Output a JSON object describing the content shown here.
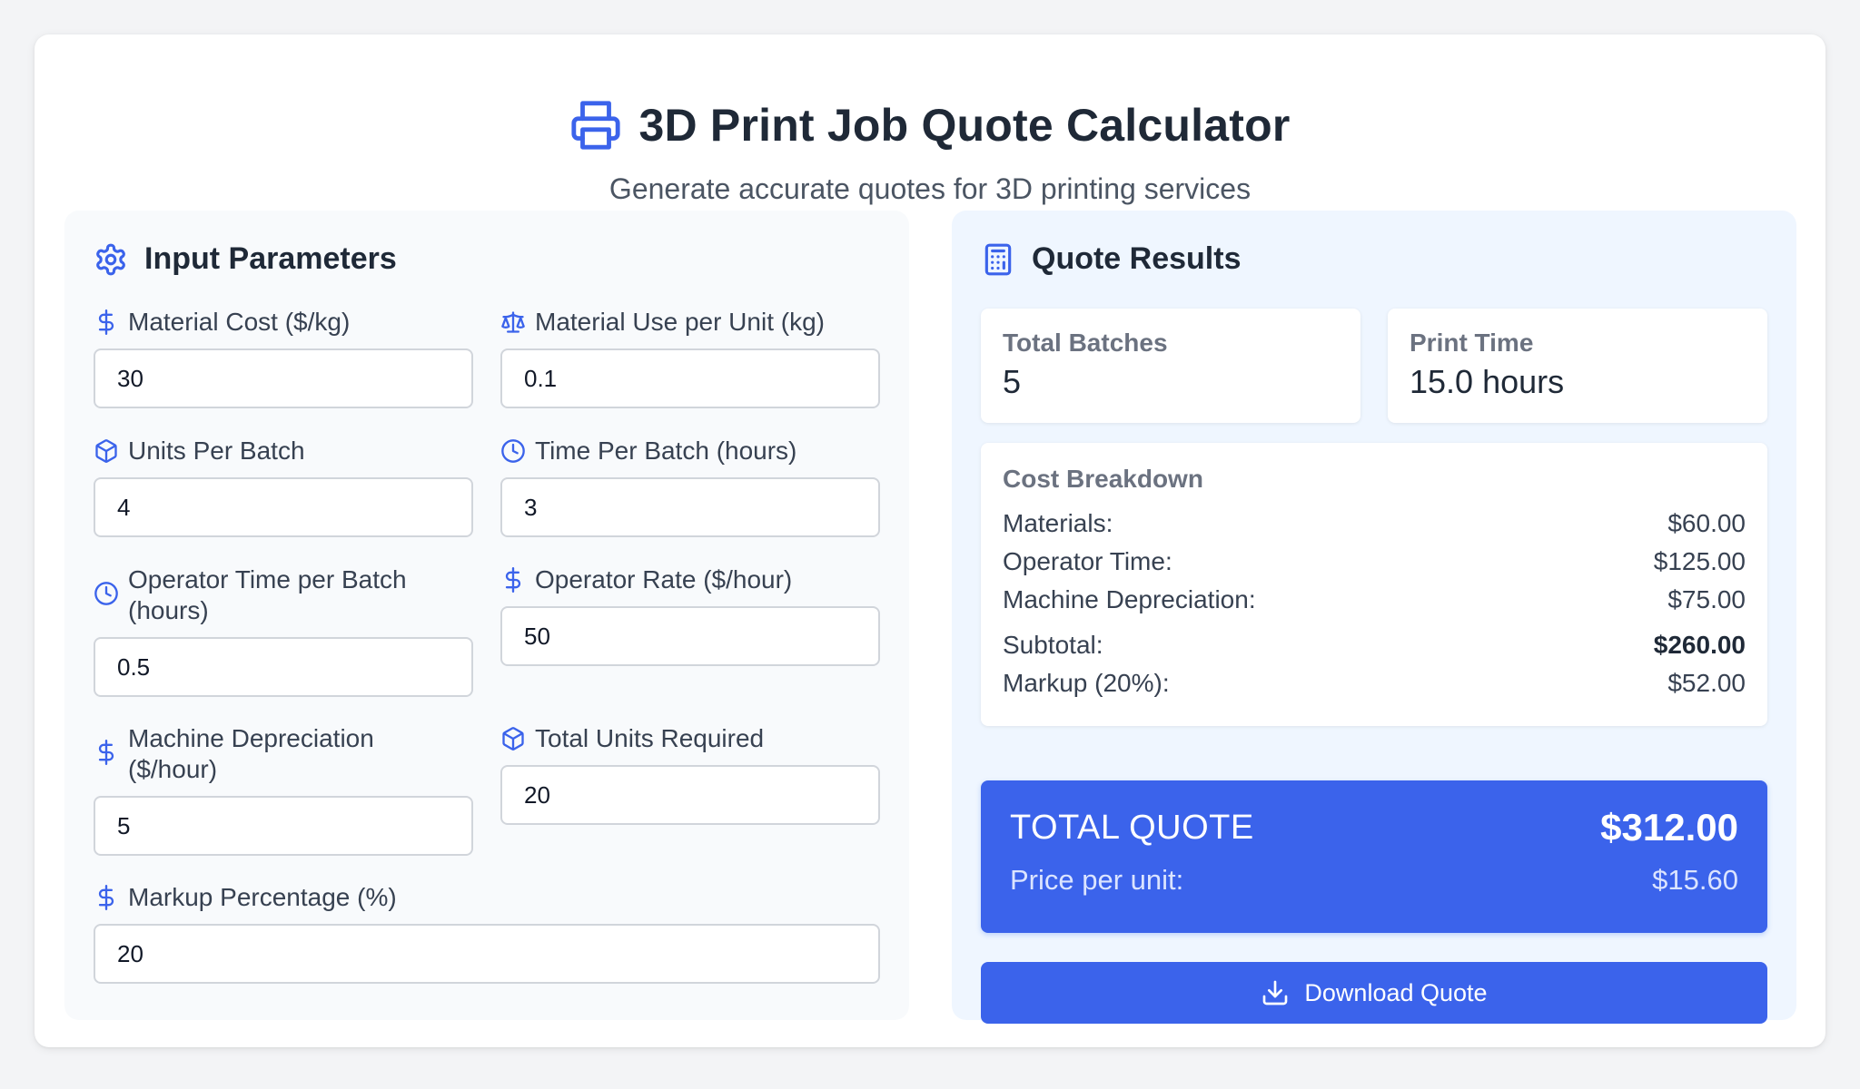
{
  "header": {
    "title": "3D Print Job Quote Calculator",
    "subtitle": "Generate accurate quotes for 3D printing services",
    "icon": "printer-icon"
  },
  "colors": {
    "accent": "#3b63eb",
    "icon": "#3b63eb",
    "panel_left_bg": "#f8fafc",
    "panel_right_bg": "#eff6ff"
  },
  "inputs": {
    "title": "Input Parameters",
    "title_icon": "gear-icon",
    "fields": [
      {
        "label": "Material Cost ($/kg)",
        "value": "30",
        "icon": "dollar-icon"
      },
      {
        "label": "Material Use per Unit (kg)",
        "value": "0.1",
        "icon": "scale-icon"
      },
      {
        "label": "Units Per Batch",
        "value": "4",
        "icon": "box-icon"
      },
      {
        "label": "Time Per Batch (hours)",
        "value": "3",
        "icon": "clock-icon"
      },
      {
        "label": "Operator Time per Batch (hours)",
        "value": "0.5",
        "icon": "clock-icon"
      },
      {
        "label": "Operator Rate ($/hour)",
        "value": "50",
        "icon": "dollar-icon"
      },
      {
        "label": "Machine Depreciation ($/hour)",
        "value": "5",
        "icon": "dollar-icon"
      },
      {
        "label": "Total Units Required",
        "value": "20",
        "icon": "box-icon"
      },
      {
        "label": "Markup Percentage (%)",
        "value": "20",
        "icon": "dollar-icon"
      }
    ]
  },
  "results": {
    "title": "Quote Results",
    "title_icon": "calculator-icon",
    "stats": [
      {
        "label": "Total Batches",
        "value": "5"
      },
      {
        "label": "Print Time",
        "value": "15.0 hours"
      }
    ],
    "breakdown": {
      "title": "Cost Breakdown",
      "rows": [
        {
          "label": "Materials:",
          "value": "$60.00"
        },
        {
          "label": "Operator Time:",
          "value": "$125.00"
        },
        {
          "label": "Machine Depreciation:",
          "value": "$75.00"
        },
        {
          "label": "Subtotal:",
          "value": "$260.00"
        },
        {
          "label": "Markup (20%):",
          "value": "$52.00"
        }
      ]
    },
    "total": {
      "label": "TOTAL QUOTE",
      "value": "$312.00",
      "per_unit_label": "Price per unit:",
      "per_unit_value": "$15.60"
    },
    "download_label": "Download Quote",
    "download_icon": "download-icon"
  }
}
